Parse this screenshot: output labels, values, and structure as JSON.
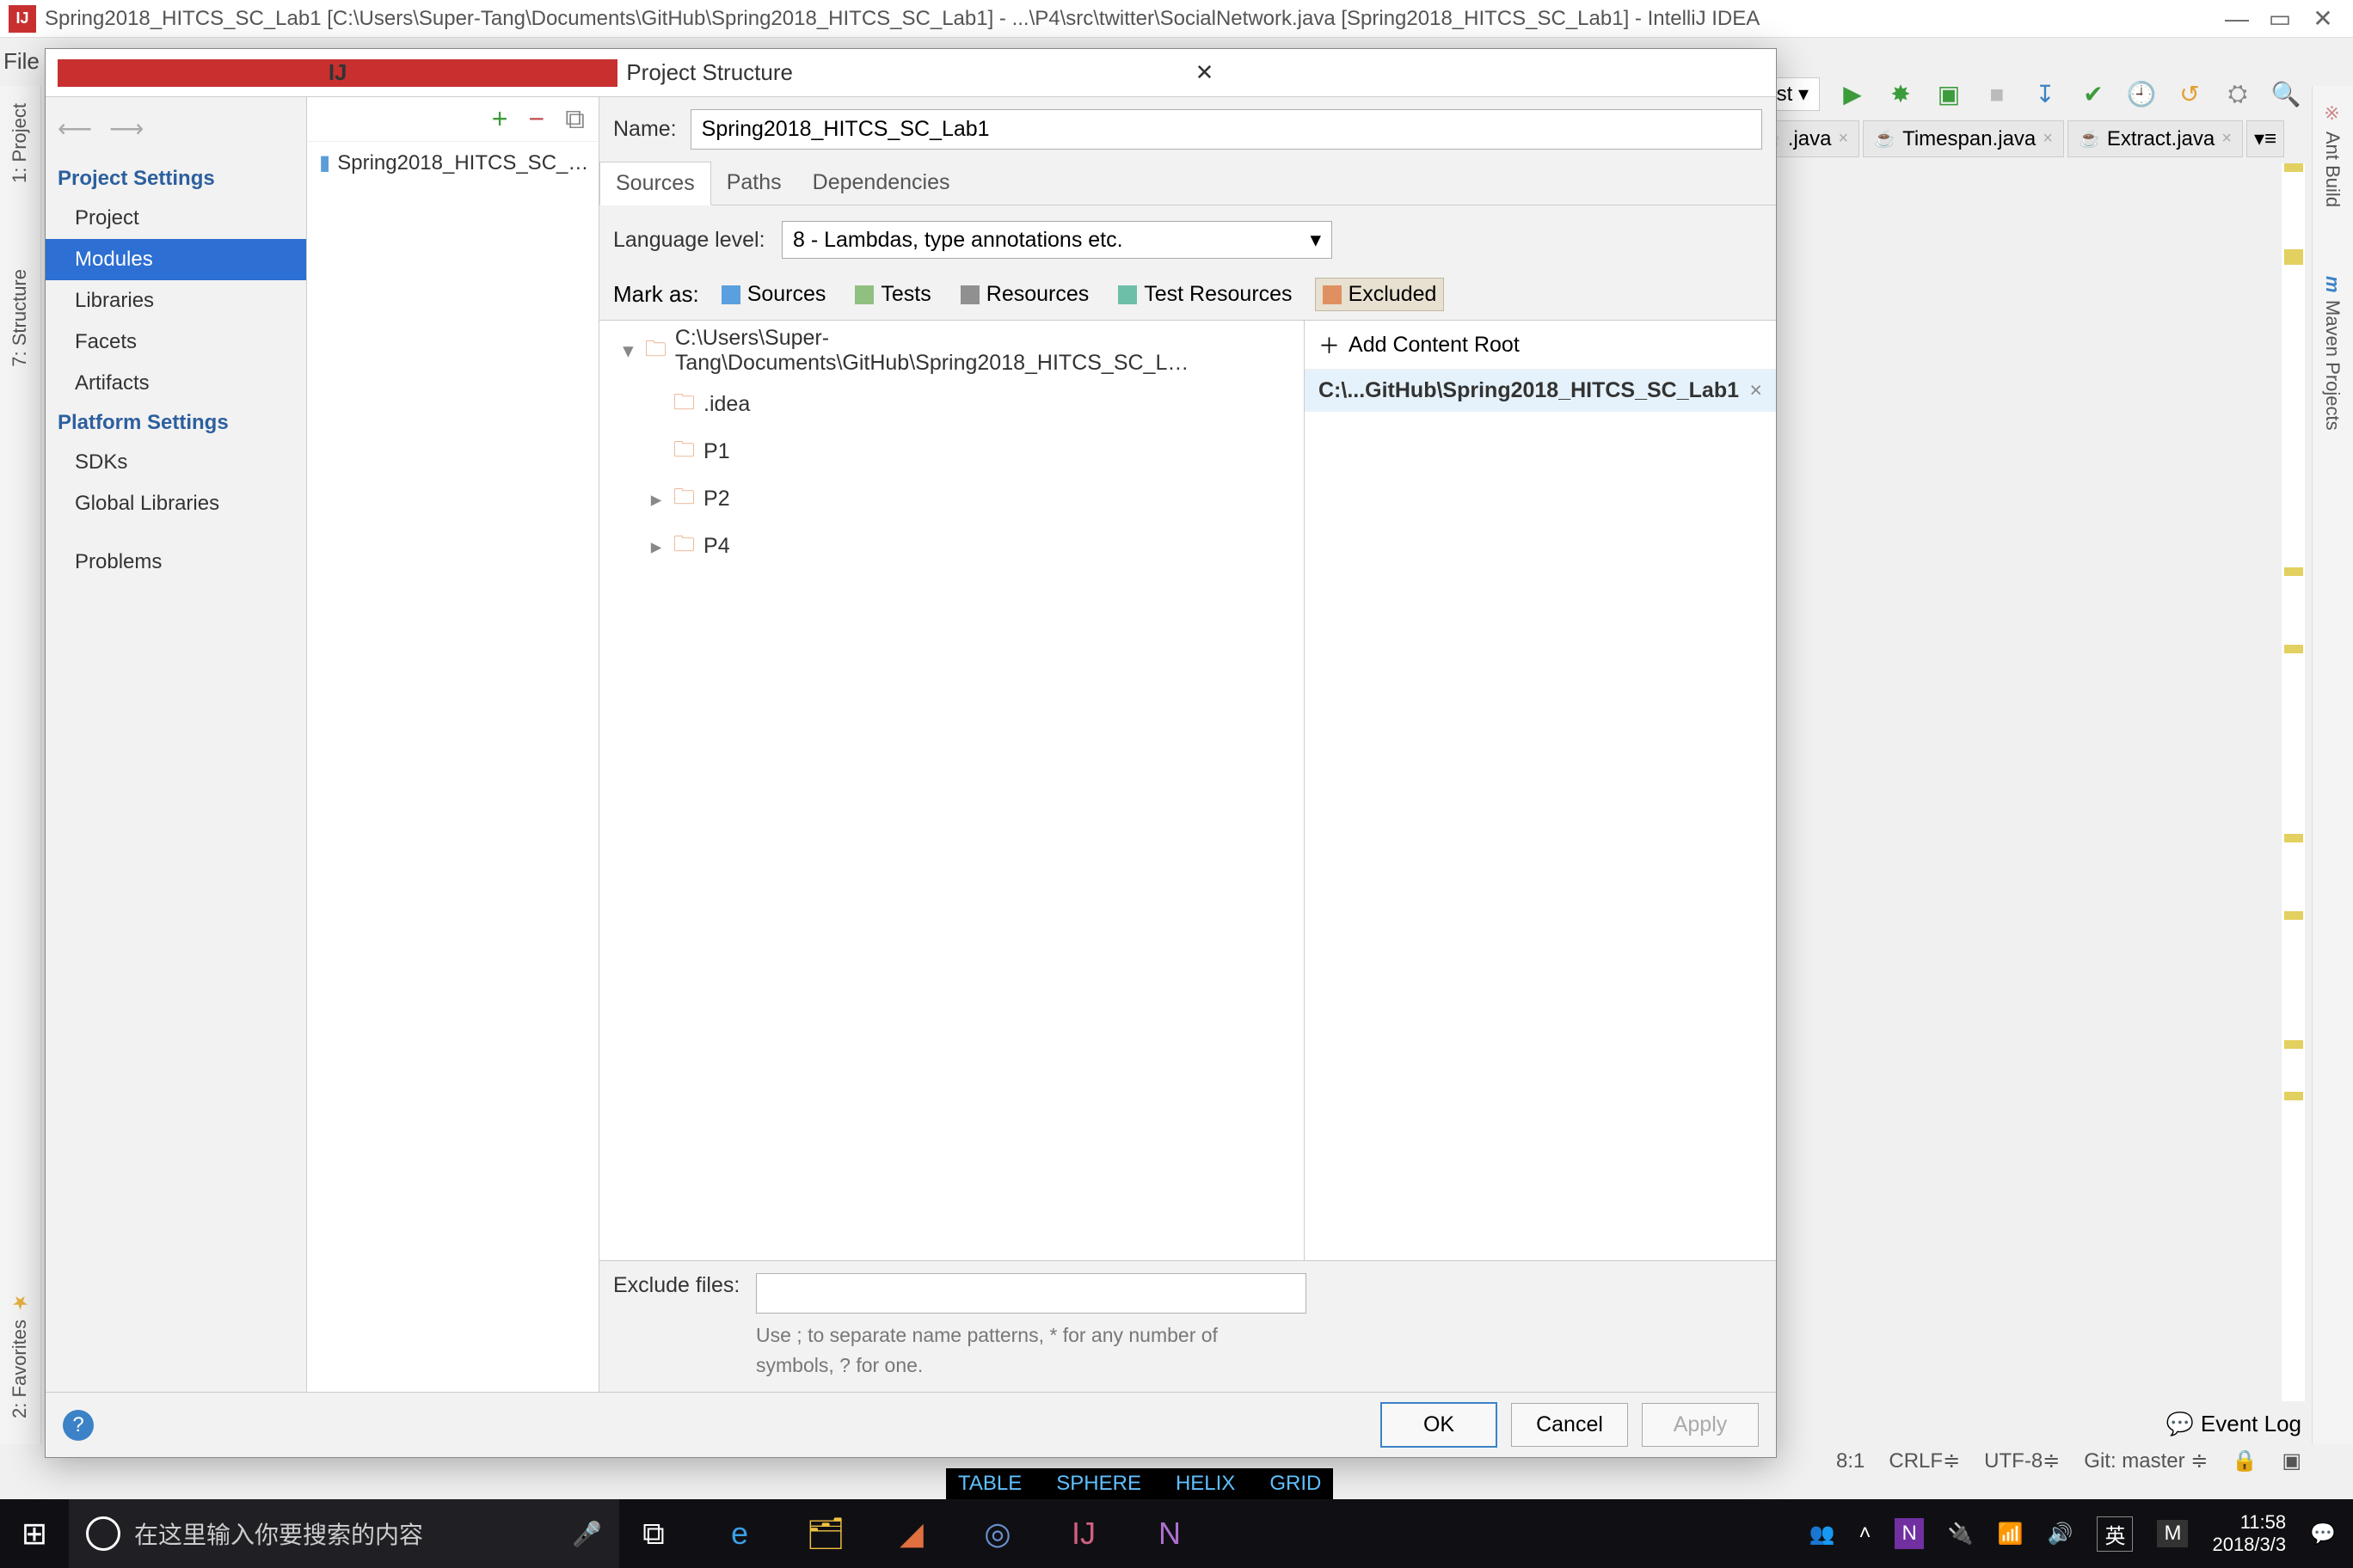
{
  "window": {
    "title": "Spring2018_HITCS_SC_Lab1 [C:\\Users\\Super-Tang\\Documents\\GitHub\\Spring2018_HITCS_SC_Lab1] - ...\\P4\\src\\twitter\\SocialNetwork.java [Spring2018_HITCS_SC_Lab1] - IntelliJ IDEA",
    "minimize": "—",
    "maximize": "▭",
    "close": "✕"
  },
  "menubar": {
    "file": "File"
  },
  "side_tabs": {
    "left": [
      "1: Project",
      "7: Structure",
      "2: Favorites"
    ],
    "right": [
      "Ant Build",
      "Maven Projects"
    ]
  },
  "toolbar": {
    "run_target": "est ▾"
  },
  "editor_tabs": [
    {
      "name": ".java"
    },
    {
      "name": "Timespan.java"
    },
    {
      "name": "Extract.java"
    }
  ],
  "dialog": {
    "title": "Project Structure",
    "nav": {
      "back": "⟵",
      "fwd": "⟶",
      "section1": "Project Settings",
      "items1": [
        "Project",
        "Modules",
        "Libraries",
        "Facets",
        "Artifacts"
      ],
      "section2": "Platform Settings",
      "items2": [
        "SDKs",
        "Global Libraries"
      ],
      "section3": "Problems",
      "selected": "Modules"
    },
    "module_toolbar": {
      "add": "+",
      "remove": "−",
      "copy": "⧉"
    },
    "module_list": [
      "Spring2018_HITCS_SC_…"
    ],
    "detail": {
      "name_label": "Name:",
      "name_value": "Spring2018_HITCS_SC_Lab1",
      "tabs": [
        "Sources",
        "Paths",
        "Dependencies"
      ],
      "active_tab": "Sources",
      "lang_label": "Language level:",
      "lang_value": "8 - Lambdas, type annotations etc.",
      "mark_label": "Mark as:",
      "marks": [
        "Sources",
        "Tests",
        "Resources",
        "Test Resources",
        "Excluded"
      ],
      "tree_root": "C:\\Users\\Super-Tang\\Documents\\GitHub\\Spring2018_HITCS_SC_L…",
      "tree": [
        ".idea",
        "P1",
        "P2",
        "P4"
      ],
      "add_root": "Add Content Root",
      "content_root": "C:\\...GitHub\\Spring2018_HITCS_SC_Lab1",
      "exclude_label": "Exclude files:",
      "exclude_hint": "Use ; to separate name patterns, * for any number of symbols, ? for one."
    },
    "buttons": {
      "ok": "OK",
      "cancel": "Cancel",
      "apply": "Apply",
      "help": "?"
    }
  },
  "statusbar": {
    "event_log": "Event Log",
    "position": "8:1",
    "line_sep": "CRLF≑",
    "encoding": "UTF-8≑",
    "git": "Git: master ≑"
  },
  "taskbar": {
    "search_placeholder": "在这里输入你要搜索的内容",
    "labels": [
      "TABLE",
      "SPHERE",
      "HELIX",
      "GRID"
    ],
    "ime": "英",
    "ime2": "M",
    "time": "11:58",
    "date": "2018/3/3"
  }
}
